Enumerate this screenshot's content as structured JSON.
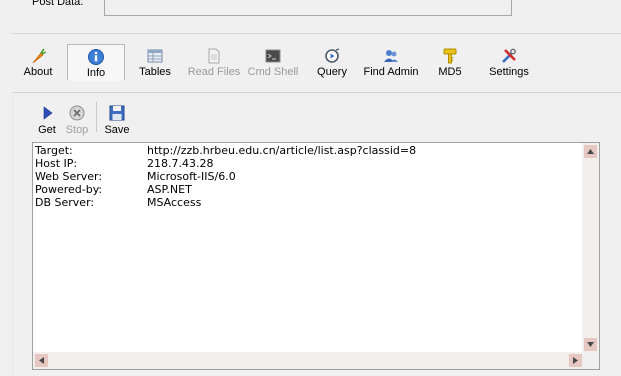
{
  "post_data": {
    "label": "Post Data:"
  },
  "toolbar": {
    "items": [
      {
        "label": "About",
        "icon": "carrot-icon"
      },
      {
        "label": "Info",
        "icon": "info-icon",
        "selected": true
      },
      {
        "label": "Tables",
        "icon": "table-icon"
      },
      {
        "label": "Read Files",
        "icon": "document-icon",
        "disabled": true
      },
      {
        "label": "Cmd Shell",
        "icon": "terminal-icon",
        "disabled": true
      },
      {
        "label": "Query",
        "icon": "query-icon"
      },
      {
        "label": "Find Admin",
        "icon": "users-icon"
      },
      {
        "label": "MD5",
        "icon": "key-icon"
      },
      {
        "label": "Settings",
        "icon": "tools-icon"
      }
    ]
  },
  "subtoolbar": {
    "get_label": "Get",
    "stop_label": "Stop",
    "save_label": "Save"
  },
  "info": {
    "rows": [
      {
        "key": "Target:",
        "value": "http://zzb.hrbeu.edu.cn/article/list.asp?classid=8"
      },
      {
        "key": "Host IP:",
        "value": "218.7.43.28"
      },
      {
        "key": "Web Server:",
        "value": "Microsoft-IIS/6.0"
      },
      {
        "key": "Powered-by:",
        "value": "ASP.NET"
      },
      {
        "key": "DB Server:",
        "value": "MSAccess"
      }
    ]
  },
  "colors": {
    "scroll_arrow_bg": "#e7c7c2",
    "selected_tab_bg": "#f7f7f7",
    "window_bg": "#f0f0f0"
  }
}
